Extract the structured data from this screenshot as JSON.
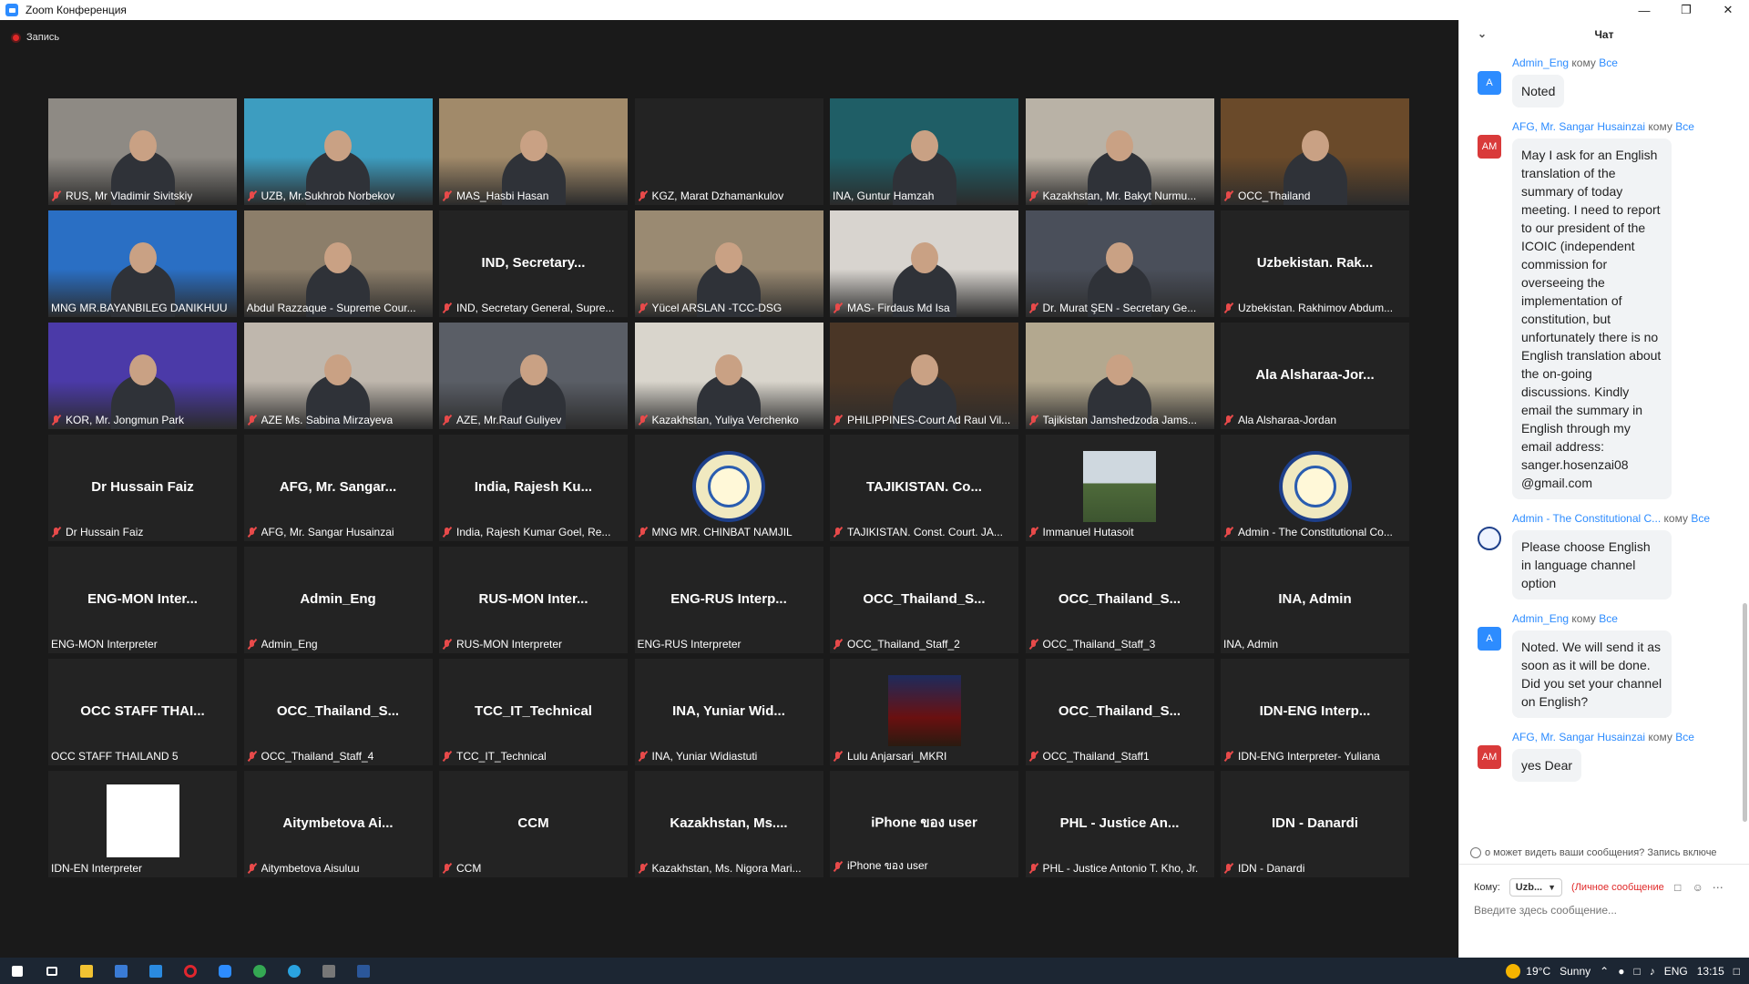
{
  "window": {
    "title": "Zoom Конференция",
    "minimize": "—",
    "maximize": "❐",
    "close": "✕"
  },
  "recording": {
    "label": "Запись"
  },
  "tiles": [
    {
      "label": "RUS, Mr Vladimir Sivitskiy",
      "video": true,
      "bg": "#8e8a84",
      "muted": true
    },
    {
      "label": "UZB, Mr.Sukhrob Norbekov",
      "video": true,
      "bg": "#3d9dc0",
      "muted": true
    },
    {
      "label": "MAS_Hasbi Hasan",
      "video": true,
      "bg": "#a18a6a",
      "muted": true
    },
    {
      "label": "KGZ, Marat Dzhamankulov",
      "video": false,
      "name": "",
      "muted": true
    },
    {
      "label": "INA, Guntur Hamzah",
      "video": true,
      "bg": "#1f5e66",
      "muted": false
    },
    {
      "label": "Kazakhstan, Mr. Bakyt Nurmu...",
      "video": true,
      "bg": "#b9b2a6",
      "muted": true
    },
    {
      "label": "OCC_Thailand",
      "video": true,
      "bg": "#6a4a2a",
      "muted": true
    },
    {
      "label": "MNG MR.BAYANBILEG DANIKHUU",
      "video": true,
      "bg": "#2a6fc4",
      "muted": false,
      "active": true
    },
    {
      "label": "Abdul Razzaque - Supreme Cour...",
      "video": true,
      "bg": "#8c7e6a",
      "muted": false
    },
    {
      "label": "IND, Secretary General, Supre...",
      "video": false,
      "name": "IND,  Secretary...",
      "muted": true
    },
    {
      "label": "Yücel ARSLAN -TCC-DSG",
      "video": true,
      "bg": "#9a8a72",
      "muted": true
    },
    {
      "label": "MAS- Firdaus Md Isa",
      "video": true,
      "bg": "#d8d4cf",
      "muted": true
    },
    {
      "label": "Dr. Murat ŞEN - Secretary Ge...",
      "video": true,
      "bg": "#4a4f5a",
      "muted": true
    },
    {
      "label": "Uzbekistan. Rakhimov Abdum...",
      "video": false,
      "name": "Uzbekistan.  Rak...",
      "muted": true
    },
    {
      "label": "KOR, Mr. Jongmun Park",
      "video": true,
      "bg": "#4b3aa8",
      "muted": true
    },
    {
      "label": "AZE Ms. Sabina Mirzayeva",
      "video": true,
      "bg": "#bfb7ad",
      "muted": true
    },
    {
      "label": "AZE, Mr.Rauf Guliyev",
      "video": true,
      "bg": "#5a5e66",
      "muted": true
    },
    {
      "label": "Kazakhstan, Yuliya Verchenko",
      "video": true,
      "bg": "#d9d5cc",
      "muted": true
    },
    {
      "label": "PHILIPPINES-Court Ad Raul Vil...",
      "video": true,
      "bg": "#4a3626",
      "muted": true
    },
    {
      "label": "Tajikistan Jamshedzoda Jams...",
      "video": true,
      "bg": "#b3a88f",
      "muted": true
    },
    {
      "label": "Ala Alsharaa-Jordan",
      "video": false,
      "name": "Ala  Alsharaa-Jor...",
      "muted": true
    },
    {
      "label": "Dr Hussain Faiz",
      "video": false,
      "name": "Dr Hussain Faiz",
      "muted": true
    },
    {
      "label": "AFG, Mr. Sangar Husainzai",
      "video": false,
      "name": "AFG,  Mr.  Sangar...",
      "muted": true
    },
    {
      "label": "India, Rajesh Kumar Goel, Re...",
      "video": false,
      "name": "India,  Rajesh  Ku...",
      "muted": true
    },
    {
      "label": "MNG MR. CHINBAT NAMJIL",
      "video": false,
      "avatar": "emblem",
      "muted": true
    },
    {
      "label": "TAJIKISTAN. Const. Court. JA...",
      "video": false,
      "name": "TAJIKISTAN.  Co...",
      "muted": true
    },
    {
      "label": "Immanuel Hutasoit",
      "video": false,
      "avatar": "photo",
      "muted": true
    },
    {
      "label": "Admin - The Constitutional Co...",
      "video": false,
      "avatar": "emblem",
      "muted": true
    },
    {
      "label": "ENG-MON Interpreter",
      "video": false,
      "name": "ENG-MON  Inter...",
      "muted": false
    },
    {
      "label": "Admin_Eng",
      "video": false,
      "name": "Admin_Eng",
      "muted": true
    },
    {
      "label": "RUS-MON Interpreter",
      "video": false,
      "name": "RUS-MON  Inter...",
      "muted": true
    },
    {
      "label": "ENG-RUS Interpreter",
      "video": false,
      "name": "ENG-RUS  Interp...",
      "muted": false
    },
    {
      "label": "OCC_Thailand_Staff_2",
      "video": false,
      "name": "OCC_Thailand_S...",
      "muted": true
    },
    {
      "label": "OCC_Thailand_Staff_3",
      "video": false,
      "name": "OCC_Thailand_S...",
      "muted": true
    },
    {
      "label": "INA, Admin",
      "video": false,
      "name": "INA,  Admin",
      "muted": false
    },
    {
      "label": "OCC STAFF THAILAND 5",
      "video": false,
      "name": "OCC  STAFF  THAI...",
      "muted": false
    },
    {
      "label": "OCC_Thailand_Staff_4",
      "video": false,
      "name": "OCC_Thailand_S...",
      "muted": true
    },
    {
      "label": "TCC_IT_Technical",
      "video": false,
      "name": "TCC_IT_Technical",
      "muted": true
    },
    {
      "label": "INA, Yuniar Widiastuti",
      "video": false,
      "name": "INA,  Yuniar  Wid...",
      "muted": true
    },
    {
      "label": "Lulu Anjarsari_MKRI",
      "video": false,
      "avatar": "poster",
      "muted": true
    },
    {
      "label": "OCC_Thailand_Staff1",
      "video": false,
      "name": "OCC_Thailand_S...",
      "muted": true
    },
    {
      "label": "IDN-ENG Interpreter- Yuliana",
      "video": false,
      "name": "IDN-ENG  Interp...",
      "muted": true
    },
    {
      "label": "IDN-EN Interpreter",
      "video": false,
      "avatar": "white",
      "muted": false
    },
    {
      "label": "Aitymbetova Aisuluu",
      "video": false,
      "name": "Aitymbetova  Ai...",
      "muted": true
    },
    {
      "label": "CCM",
      "video": false,
      "name": "CCM",
      "muted": true
    },
    {
      "label": "Kazakhstan, Ms. Nigora Mari...",
      "video": false,
      "name": "Kazakhstan,  Ms....",
      "muted": true
    },
    {
      "label": "iPhone ของ user",
      "video": false,
      "name": "iPhone  ของ  user",
      "muted": true
    },
    {
      "label": "PHL - Justice Antonio T. Kho, Jr.",
      "video": false,
      "name": "PHL  -  Justice  An...",
      "muted": true
    },
    {
      "label": "IDN - Danardi",
      "video": false,
      "name": "IDN  -  Danardi",
      "muted": true
    }
  ],
  "chat": {
    "title": "Чат",
    "messages": [
      {
        "from": "Admin_Eng",
        "to_word": "кому",
        "to": "Все",
        "avatar": "A",
        "avatar_style": "blue",
        "text": "Noted"
      },
      {
        "from": "AFG, Mr. Sangar Husainzai",
        "to_word": "кому",
        "to": "Все",
        "avatar": "AM",
        "avatar_style": "red",
        "text": "May I ask for an English translation of the summary of today meeting. I need to report to our president of the ICOIC (independent commission for overseeing the implementation of constitution, but unfortunately there is no English translation about the on-going discussions. Kindly email the summary in English through my email address: sanger.hosenzai08 @gmail.com"
      },
      {
        "from": "Admin - The Constitutional C...",
        "to_word": "кому",
        "to": "Все",
        "avatar": "",
        "avatar_style": "emb",
        "text": "Please choose English in language channel option"
      },
      {
        "from": "Admin_Eng",
        "to_word": "кому",
        "to": "Все",
        "avatar": "A",
        "avatar_style": "blue",
        "text": "Noted. We will send it as soon as it will be done. Did you set your channel on English?"
      },
      {
        "from": "AFG, Mr. Sangar Husainzai",
        "to_word": "кому",
        "to": "Все",
        "avatar": "AM",
        "avatar_style": "red",
        "text": "yes Dear"
      }
    ],
    "privacy_note": "о может видеть ваши сообщения? Запись включе",
    "to_label": "Кому:",
    "to_value": "Uzb...",
    "private_note": "(Личное сообщение",
    "input_placeholder": "Введите здесь сообщение..."
  },
  "taskbar": {
    "temperature": "19°C",
    "weather": "Sunny",
    "lang": "ENG",
    "time": "13:15"
  }
}
